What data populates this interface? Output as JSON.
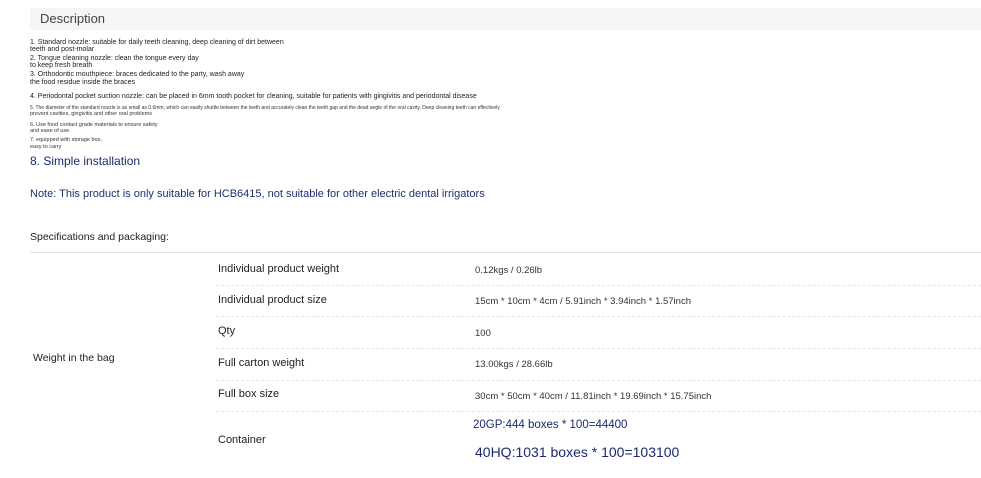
{
  "description": {
    "header": "Description",
    "lines": [
      "1. Standard nozzle: suitable for daily teeth cleaning, deep cleaning of dirt between",
      "teeth and post-molar",
      "2. Tongue cleaning nozzle: clean the tongue every day",
      "to keep fresh breath",
      "3. Orthodontic mouthpiece: braces dedicated to the party, wash away",
      "the food residue inside the braces",
      "4. Periodontal pocket suction nozzle: can be placed in 6mm tooth pocket for cleaning, suitable for patients with gingivitis and periodontal disease",
      "5. The diameter of the standard nozzle is as small as 0.6mm, which can easily shuttle between the teeth and accurately clean the teeth gap and the dead angle of the oral cavity. Deep cleaning teeth can effectively",
      "prevent cavities, gingivitis and other oral problems",
      "6. Use food contact grade materials to ensure safety",
      "and ease of use",
      "7. equipped with storage box,",
      "easy to carry"
    ],
    "item8": "8. Simple installation"
  },
  "note": "Note: This product is only suitable for HCB6415, not suitable for other electric dental irrigators",
  "specs": {
    "title": "Specifications and packaging:",
    "group_label": "Weight in the bag",
    "rows": [
      {
        "label": "Individual product weight",
        "value": "0.12kgs / 0.26lb"
      },
      {
        "label": "Individual product size",
        "value": "15cm * 10cm * 4cm / 5.91inch * 3.94inch * 1.57inch"
      },
      {
        "label": "Qty",
        "value": "100"
      },
      {
        "label": "Full carton weight",
        "value": "13.00kgs / 28.66lb"
      },
      {
        "label": "Full box size",
        "value": "30cm * 50cm * 40cm / 11.81inch * 19.69inch * 15.75inch"
      },
      {
        "label": "Container",
        "value": "20GP:444 boxes * 100=44400",
        "value2": "40HQ:1031 boxes * 100=103100"
      }
    ]
  }
}
